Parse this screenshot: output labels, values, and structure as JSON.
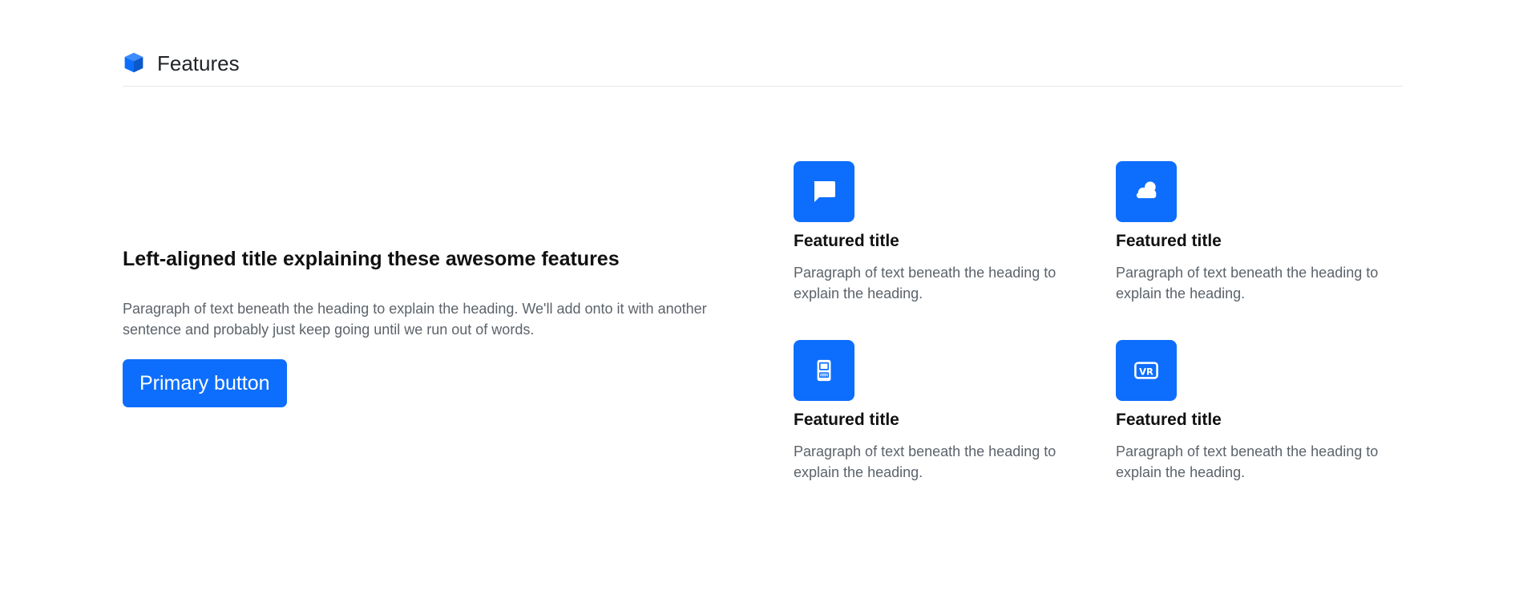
{
  "header": {
    "icon": "box-icon",
    "title": "Features"
  },
  "intro": {
    "heading": "Left-aligned title explaining these awesome features",
    "paragraph": "Paragraph of text beneath the heading to explain the heading. We'll add onto it with another sentence and probably just keep going until we run out of words.",
    "button_label": "Primary button"
  },
  "features": [
    {
      "icon": "chat-icon",
      "title": "Featured title",
      "text": "Paragraph of text beneath the heading to explain the heading."
    },
    {
      "icon": "cloud-icon",
      "title": "Featured title",
      "text": "Paragraph of text beneath the heading to explain the heading."
    },
    {
      "icon": "device-icon",
      "title": "Featured title",
      "text": "Paragraph of text beneath the heading to explain the heading."
    },
    {
      "icon": "vr-icon",
      "title": "Featured title",
      "text": "Paragraph of text beneath the heading to explain the heading.",
      "badge": "VR"
    }
  ],
  "colors": {
    "accent": "#0d6efd",
    "muted_text": "#5c636a",
    "divider": "#e3e5e8"
  }
}
